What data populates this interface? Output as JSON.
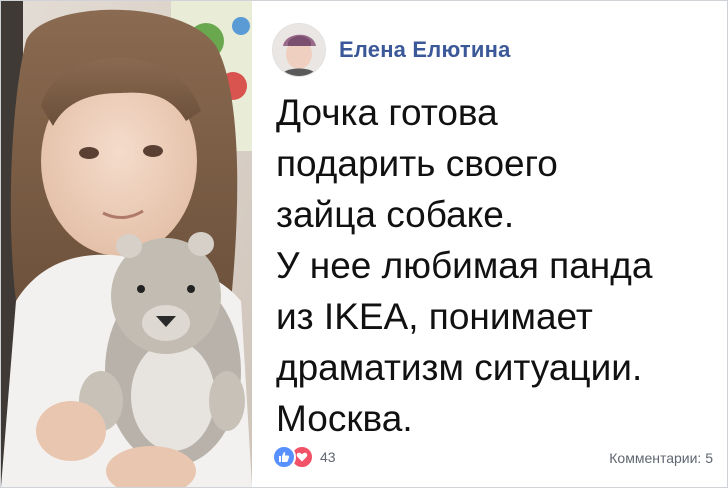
{
  "post": {
    "author": "Елена Елютина",
    "text_lines": [
      "Дочка готова",
      "подарить своего",
      "зайца собаке.",
      "У нее любимая панда",
      "из IKEA, понимает",
      "драматизм ситуации.",
      "Москва."
    ],
    "reactions": {
      "icons": [
        "like-icon",
        "heart-icon"
      ],
      "count": "43"
    },
    "comments_label": "Комментарии: 5"
  },
  "colors": {
    "author_name": "#3b5998",
    "like": "#5890ff",
    "love": "#f25268",
    "meta_text": "#606770"
  }
}
